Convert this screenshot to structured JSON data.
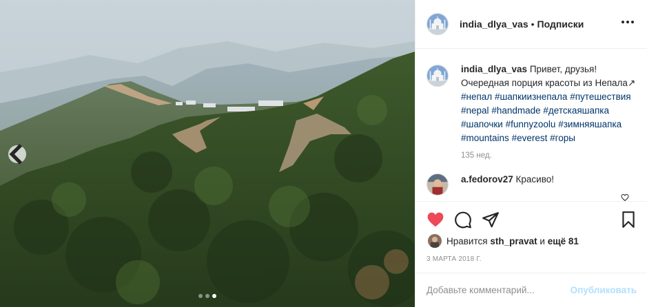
{
  "post": {
    "username": "india_dlya_vas",
    "separator": "•",
    "follow_label": "Подписки",
    "avatar_icon": "taj-mahal-avatar",
    "caption": {
      "username": "india_dlya_vas",
      "text_1": "Привет, друзья! Очередная порция красоты из Непала",
      "text_2": "",
      "hashtags": [
        "#непал",
        "#шапкиизнепала",
        "#путешествия",
        "#nepal",
        "#handmade",
        "#детскаяшапка",
        "#шапочки",
        "#funnyzoolu",
        "#зимняяшапка",
        "#mountains",
        "#everest",
        "#горы"
      ],
      "time": "135 нед."
    },
    "comments": [
      {
        "username": "a.fedorov27",
        "text": "Красиво!"
      }
    ],
    "likes": {
      "prefix": "Нравится",
      "user": "sth_pravat",
      "middle": "и",
      "count_text": "ещё 81"
    },
    "date": "3 МАРТА 2018 Г.",
    "add_comment": {
      "placeholder": "Добавьте комментарий...",
      "publish_label": "Опубликовать"
    },
    "carousel": {
      "slides": 3,
      "active_index": 2
    },
    "colors": {
      "like": "#ed4956",
      "link": "#003569",
      "publish_disabled": "#b2dffc",
      "muted": "#8e8e8e"
    }
  }
}
